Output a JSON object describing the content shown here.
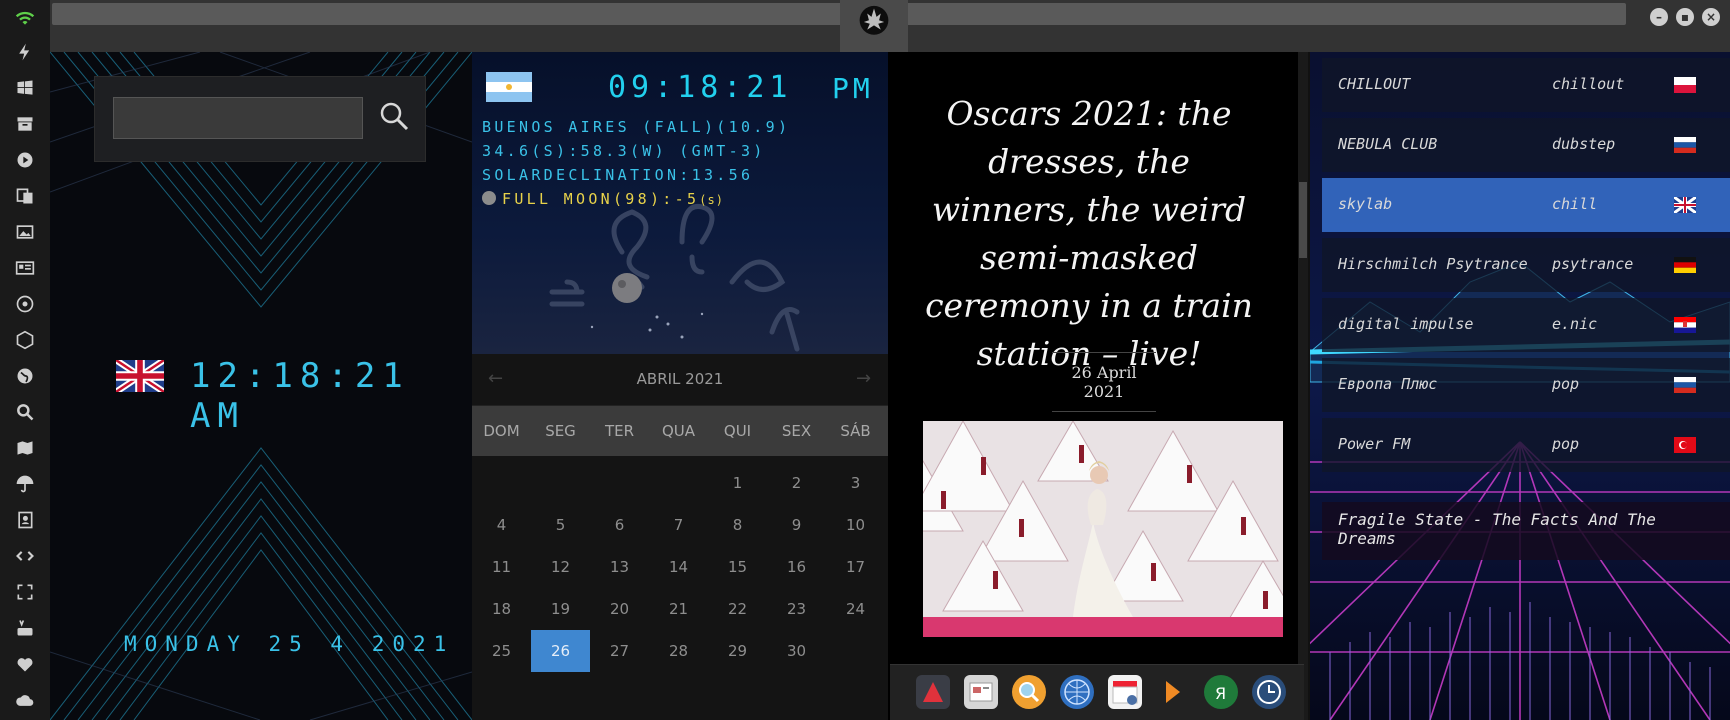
{
  "sidebar": {
    "icons": [
      "wifi-icon",
      "lightning-icon",
      "windows-icon",
      "archive-icon",
      "play-icon",
      "translate-icon",
      "image-icon",
      "news-icon",
      "settings-icon",
      "hexagon-icon",
      "globe-icon",
      "search-icon",
      "map-icon",
      "umbrella-icon",
      "contacts-icon",
      "code-icon",
      "fullscreen-icon",
      "youtube-icon",
      "heart-icon",
      "cloud-icon"
    ]
  },
  "topbar": {
    "emblem": "rebel-alliance-icon",
    "buttons": [
      "minimize",
      "maximize",
      "close"
    ]
  },
  "clock_uk": {
    "search_placeholder": "",
    "time": "12:18:21  AM",
    "date": "MONDAY 25 4 2021"
  },
  "astro": {
    "time": "09:18:21",
    "ampm": "PM",
    "line1": "BUENOS AIRES (FALL)(10.9)",
    "line2": "34.6(S):58.3(W) (GMT-3)",
    "line3": "SOLARDECLINATION:13.56",
    "line4": "FULL MOON(98):-5",
    "line4_suffix": "(s)"
  },
  "calendar": {
    "title": "ABRIL 2021",
    "prev": "←",
    "next": "→",
    "weekdays": [
      "DOM",
      "SEG",
      "TER",
      "QUA",
      "QUI",
      "SEX",
      "SÁB"
    ],
    "days": [
      "1",
      "2",
      "3",
      "4",
      "5",
      "6",
      "7",
      "8",
      "9",
      "10",
      "11",
      "12",
      "13",
      "14",
      "15",
      "16",
      "17",
      "18",
      "19",
      "20",
      "21",
      "22",
      "23",
      "24",
      "25",
      "26",
      "27",
      "28",
      "29",
      "30"
    ],
    "first_weekday_index": 4,
    "selected": "26"
  },
  "news": {
    "title": "Oscars 2021: the dresses, the winners, the weird semi-masked ceremony in a train station – live!",
    "date": "26 April 2021"
  },
  "dock": {
    "apps": [
      "app-store-icon",
      "notes-icon",
      "finder-search-icon",
      "browser-globe-icon",
      "calendar-icon",
      "arrow-app-icon",
      "yandex-icon",
      "time-machine-icon"
    ]
  },
  "radio": {
    "stations": [
      {
        "name": "CHILLOUT",
        "genre": "chillout",
        "flag": "poland"
      },
      {
        "name": "NEBULA CLUB",
        "genre": "dubstep",
        "flag": "russia"
      },
      {
        "name": "skylab",
        "genre": "chill",
        "flag": "uk"
      },
      {
        "name": "Hirschmilch Psytrance",
        "genre": "psytrance",
        "flag": "germany"
      },
      {
        "name": "digital impulse",
        "genre": "e.nic",
        "flag": "croatia"
      },
      {
        "name": "Европа Плюс",
        "genre": "pop",
        "flag": "russia"
      },
      {
        "name": "Power FM",
        "genre": "pop",
        "flag": "turkey"
      }
    ],
    "selected": "skylab",
    "now_playing": "Fragile State - The Facts And The Dreams"
  }
}
